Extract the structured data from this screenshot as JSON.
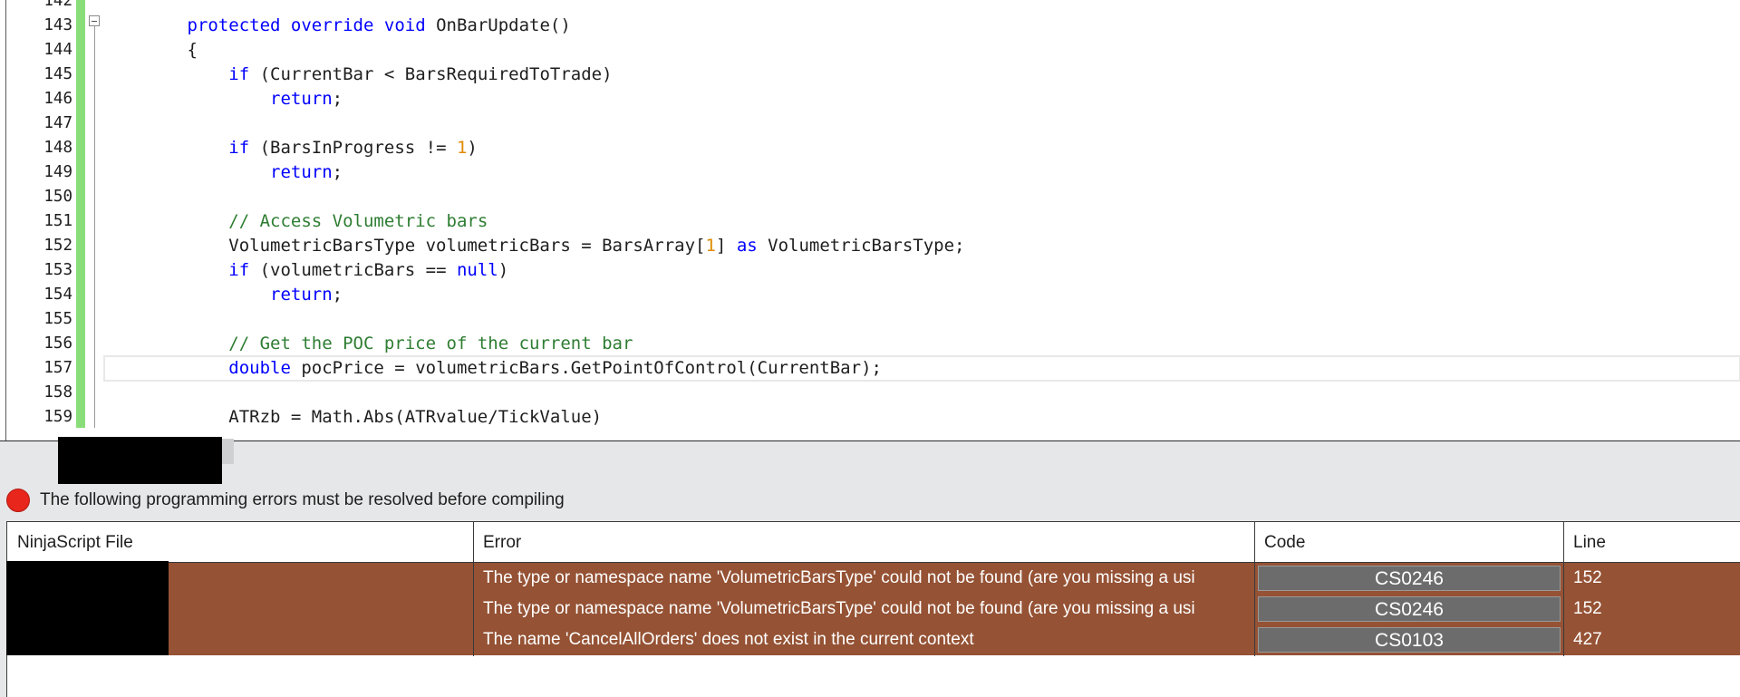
{
  "editor": {
    "lines": [
      {
        "num": "142",
        "segments": []
      },
      {
        "num": "143",
        "segments": [
          {
            "t": "        "
          },
          {
            "t": "protected",
            "c": "kw"
          },
          {
            "t": " "
          },
          {
            "t": "override",
            "c": "kw"
          },
          {
            "t": " "
          },
          {
            "t": "void",
            "c": "kw"
          },
          {
            "t": " OnBarUpdate()"
          }
        ]
      },
      {
        "num": "144",
        "segments": [
          {
            "t": "        {"
          }
        ]
      },
      {
        "num": "145",
        "segments": [
          {
            "t": "            "
          },
          {
            "t": "if",
            "c": "kw"
          },
          {
            "t": " (CurrentBar < BarsRequiredToTrade)"
          }
        ]
      },
      {
        "num": "146",
        "segments": [
          {
            "t": "                "
          },
          {
            "t": "return",
            "c": "kw"
          },
          {
            "t": ";"
          }
        ]
      },
      {
        "num": "147",
        "segments": []
      },
      {
        "num": "148",
        "segments": [
          {
            "t": "            "
          },
          {
            "t": "if",
            "c": "kw"
          },
          {
            "t": " (BarsInProgress != "
          },
          {
            "t": "1",
            "c": "nm"
          },
          {
            "t": ")"
          }
        ]
      },
      {
        "num": "149",
        "segments": [
          {
            "t": "                "
          },
          {
            "t": "return",
            "c": "kw"
          },
          {
            "t": ";"
          }
        ]
      },
      {
        "num": "150",
        "segments": []
      },
      {
        "num": "151",
        "segments": [
          {
            "t": "            "
          },
          {
            "t": "// Access Volumetric bars",
            "c": "cm"
          }
        ]
      },
      {
        "num": "152",
        "segments": [
          {
            "t": "            VolumetricBarsType volumetricBars = BarsArray["
          },
          {
            "t": "1",
            "c": "nm"
          },
          {
            "t": "] "
          },
          {
            "t": "as",
            "c": "kw"
          },
          {
            "t": " VolumetricBarsType;"
          }
        ]
      },
      {
        "num": "153",
        "segments": [
          {
            "t": "            "
          },
          {
            "t": "if",
            "c": "kw"
          },
          {
            "t": " (volumetricBars == "
          },
          {
            "t": "null",
            "c": "kw"
          },
          {
            "t": ")"
          }
        ]
      },
      {
        "num": "154",
        "segments": [
          {
            "t": "                "
          },
          {
            "t": "return",
            "c": "kw"
          },
          {
            "t": ";"
          }
        ]
      },
      {
        "num": "155",
        "segments": []
      },
      {
        "num": "156",
        "segments": [
          {
            "t": "            "
          },
          {
            "t": "// Get the POC price of the current bar",
            "c": "cm"
          }
        ]
      },
      {
        "num": "157",
        "current": true,
        "segments": [
          {
            "t": "            "
          },
          {
            "t": "double",
            "c": "kw"
          },
          {
            "t": " pocPrice = volumetricBars.GetPointOfControl(CurrentBar);"
          }
        ]
      },
      {
        "num": "158",
        "segments": []
      },
      {
        "num": "159",
        "segments": [
          {
            "t": "            ATRzb = Math.Abs(ATRvalue/TickValue)"
          }
        ]
      }
    ]
  },
  "status": {
    "message": "The following programming errors must be resolved before compiling"
  },
  "errors_grid": {
    "columns": [
      "NinjaScript File",
      "Error",
      "Code",
      "Line"
    ],
    "rows": [
      {
        "file": "",
        "error": "The type or namespace name 'VolumetricBarsType' could not be found (are you missing a usi",
        "code": "CS0246",
        "line": "152"
      },
      {
        "file": "",
        "error": "The type or namespace name 'VolumetricBarsType' could not be found (are you missing a usi",
        "code": "CS0246",
        "line": "152"
      },
      {
        "file": "",
        "error": "The name 'CancelAllOrders' does not exist in the current context",
        "code": "CS0103",
        "line": "427"
      }
    ]
  },
  "colors": {
    "error_row_bg": "#955234",
    "change_bar": "#8ade7a",
    "keyword": "#0000ff",
    "comment": "#2e7d32",
    "number": "#e08a00",
    "error_icon": "#e8261b"
  },
  "icons": {
    "fold": "collapse-minus-icon",
    "status": "error-dot-icon"
  }
}
